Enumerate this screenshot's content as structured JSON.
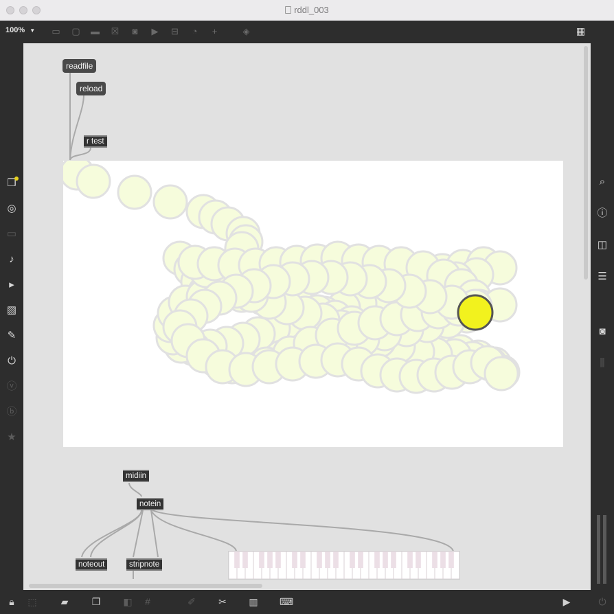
{
  "window": {
    "title": "rddl_003"
  },
  "toolbar": {
    "zoom_label": "100%",
    "zoom_caret": "▼",
    "icons": [
      "presentation-icon",
      "comment-box-icon",
      "comment-icon",
      "button-icon",
      "toggle-icon",
      "message-icon",
      "slider-icon",
      "dial-icon",
      "add-icon",
      "paint-bucket-icon"
    ],
    "grid_icon": "grid-icon"
  },
  "left_sidebar": [
    "objects-icon",
    "record-icon",
    "device-icon",
    "music-note-icon",
    "playlist-icon",
    "image-icon",
    "clip-icon",
    "plug-icon",
    "v-circle-icon",
    "b-circle-icon",
    "star-icon"
  ],
  "right_sidebar": [
    "search-icon",
    "info-icon",
    "reference-icon",
    "list-icon",
    "snapshot-icon",
    "mixer-icon"
  ],
  "patch": {
    "readfile": "readfile",
    "reload": "reload",
    "r_test": "r test",
    "midiin": "midiin",
    "notein": "notein",
    "noteout": "noteout",
    "stripnote": "stripnote"
  },
  "lcd": {
    "trail_color": "#f6fcdc",
    "trail_stroke": "#e1e1e1",
    "current_color": "#f2f21e",
    "current_stroke": "#555555"
  },
  "bottom_bar": [
    "lock-icon",
    "edit-icon",
    "presentation-icon",
    "windows-icon",
    "hide-icon",
    "grid-icon",
    "patch-cord-icon",
    "wrench-icon",
    "piano-icon",
    "keyboard-icon",
    "play-icon",
    "power-icon"
  ]
}
